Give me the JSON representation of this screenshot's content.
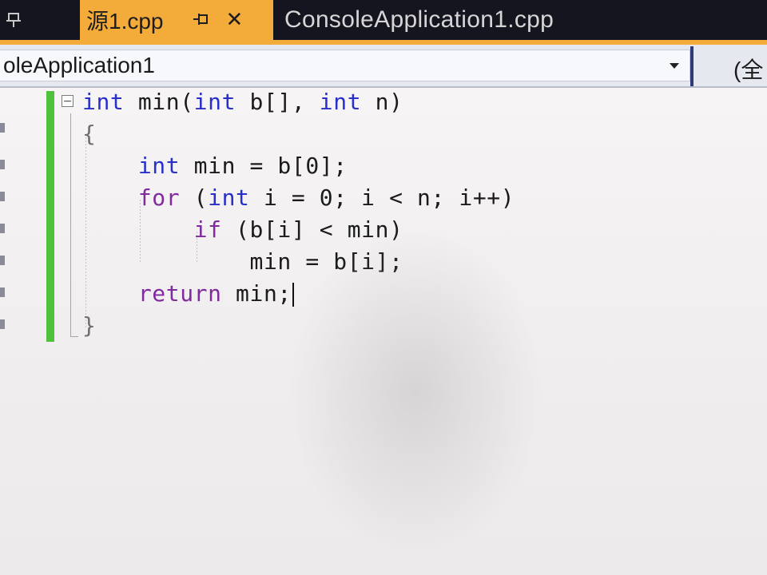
{
  "tabs": {
    "left_pin_icon": "pin-icon",
    "active": {
      "label": "源1.cpp",
      "pin_glyph": "⊸",
      "close_glyph": "✕"
    },
    "inactive": {
      "label": "ConsoleApplication1.cpp"
    },
    "accent_color": "#f3ab3a"
  },
  "navbar": {
    "project": "oleApplication1",
    "scope": "(全"
  },
  "editor": {
    "collapse_glyph": "−",
    "lines": [
      {
        "segments": [
          {
            "t": "int",
            "c": "kw-blue"
          },
          {
            "t": " min(",
            "c": ""
          },
          {
            "t": "int",
            "c": "kw-blue"
          },
          {
            "t": " b[], ",
            "c": ""
          },
          {
            "t": "int",
            "c": "kw-blue"
          },
          {
            "t": " n)",
            "c": ""
          }
        ]
      },
      {
        "segments": [
          {
            "t": "{",
            "c": "gray"
          }
        ]
      },
      {
        "segments": [
          {
            "t": "    ",
            "c": ""
          },
          {
            "t": "int",
            "c": "kw-blue"
          },
          {
            "t": " min = b[0];",
            "c": ""
          }
        ]
      },
      {
        "segments": [
          {
            "t": "    ",
            "c": ""
          },
          {
            "t": "for",
            "c": "kw-purple"
          },
          {
            "t": " (",
            "c": ""
          },
          {
            "t": "int",
            "c": "kw-blue"
          },
          {
            "t": " i = 0; i < n; i++)",
            "c": ""
          }
        ]
      },
      {
        "segments": [
          {
            "t": "        ",
            "c": ""
          },
          {
            "t": "if",
            "c": "kw-purple"
          },
          {
            "t": " (b[i] < min)",
            "c": ""
          }
        ]
      },
      {
        "segments": [
          {
            "t": "            min = b[i];",
            "c": ""
          }
        ]
      },
      {
        "segments": [
          {
            "t": "    ",
            "c": ""
          },
          {
            "t": "return",
            "c": "kw-purple"
          },
          {
            "t": " min;",
            "c": ""
          }
        ],
        "cursor": true
      },
      {
        "segments": [
          {
            "t": "}",
            "c": "gray"
          }
        ]
      }
    ]
  }
}
